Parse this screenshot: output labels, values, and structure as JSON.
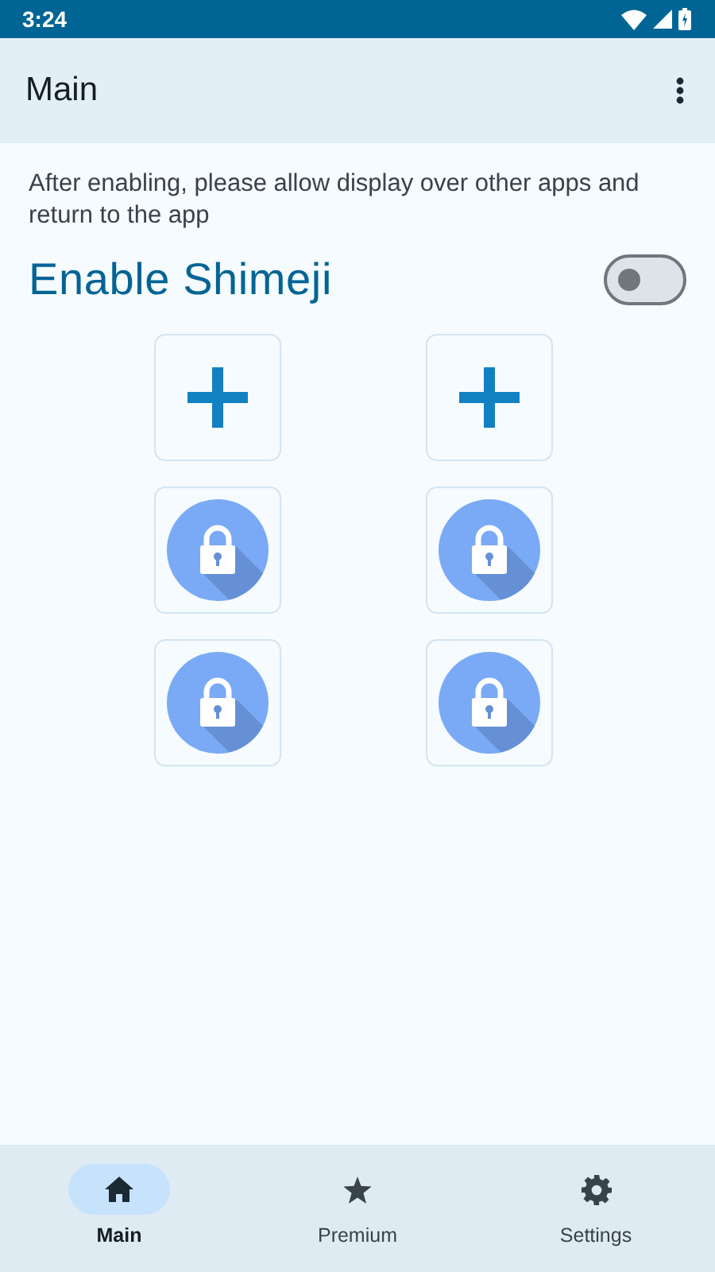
{
  "status_bar": {
    "time": "3:24"
  },
  "app_bar": {
    "title": "Main"
  },
  "notice": "After enabling, please allow display over other apps and return to the app",
  "enable_switch": {
    "label": "Enable Shimeji",
    "on": false
  },
  "tiles": [
    {
      "kind": "add"
    },
    {
      "kind": "add"
    },
    {
      "kind": "locked"
    },
    {
      "kind": "locked"
    },
    {
      "kind": "locked"
    },
    {
      "kind": "locked"
    }
  ],
  "nav": [
    {
      "label": "Main",
      "kind": "home",
      "selected": true
    },
    {
      "label": "Premium",
      "kind": "premium",
      "selected": false
    },
    {
      "label": "Settings",
      "kind": "settings",
      "selected": false
    }
  ]
}
